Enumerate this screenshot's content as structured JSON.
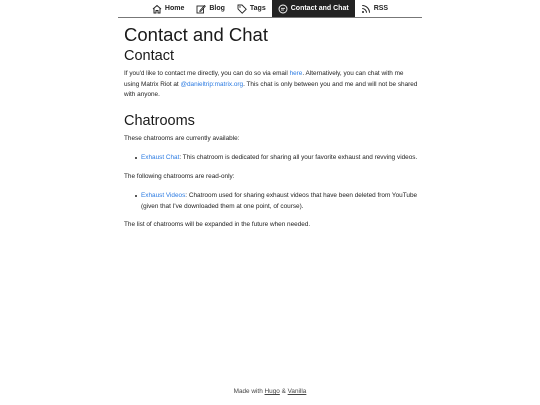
{
  "nav": {
    "items": [
      {
        "label": "Home",
        "icon": "home-icon"
      },
      {
        "label": "Blog",
        "icon": "edit-icon"
      },
      {
        "label": "Tags",
        "icon": "tag-icon"
      },
      {
        "label": "Contact and Chat",
        "icon": "chat-icon",
        "active": true
      },
      {
        "label": "RSS",
        "icon": "rss-icon"
      }
    ]
  },
  "page": {
    "title": "Contact and Chat",
    "contact": {
      "heading": "Contact",
      "text_1": "If you'd like to contact me directly, you can do so via email ",
      "email_link": "here",
      "text_2": ". Alternatively, you can chat with me using Matrix Riot at ",
      "matrix_link": "@danieltrip:matrix.org",
      "text_3": ". This chat is only between you and me and will not be shared with anyone."
    },
    "chatrooms": {
      "heading": "Chatrooms",
      "intro": "These chatrooms are currently available:",
      "available": [
        {
          "link": "Exhaust Chat",
          "text": ": This chatroom is dedicated for sharing all your favorite exhaust and revving videos."
        }
      ],
      "readonly_intro": "The following chatrooms are read-only:",
      "readonly": [
        {
          "link": "Exhaust Videos",
          "text": ": Chatroom used for sharing exhaust videos that have been deleted from YouTube (given that I've downloaded them at one point, of course)."
        }
      ],
      "outro": "The list of chatrooms will be expanded in the future when needed."
    }
  },
  "footer": {
    "prefix": "Made with ",
    "hugo": "Hugo",
    "amp": " & ",
    "vanilla": "Vanilla"
  },
  "colors": {
    "link": "#2a7ae2",
    "nav_active_bg": "#222222"
  }
}
